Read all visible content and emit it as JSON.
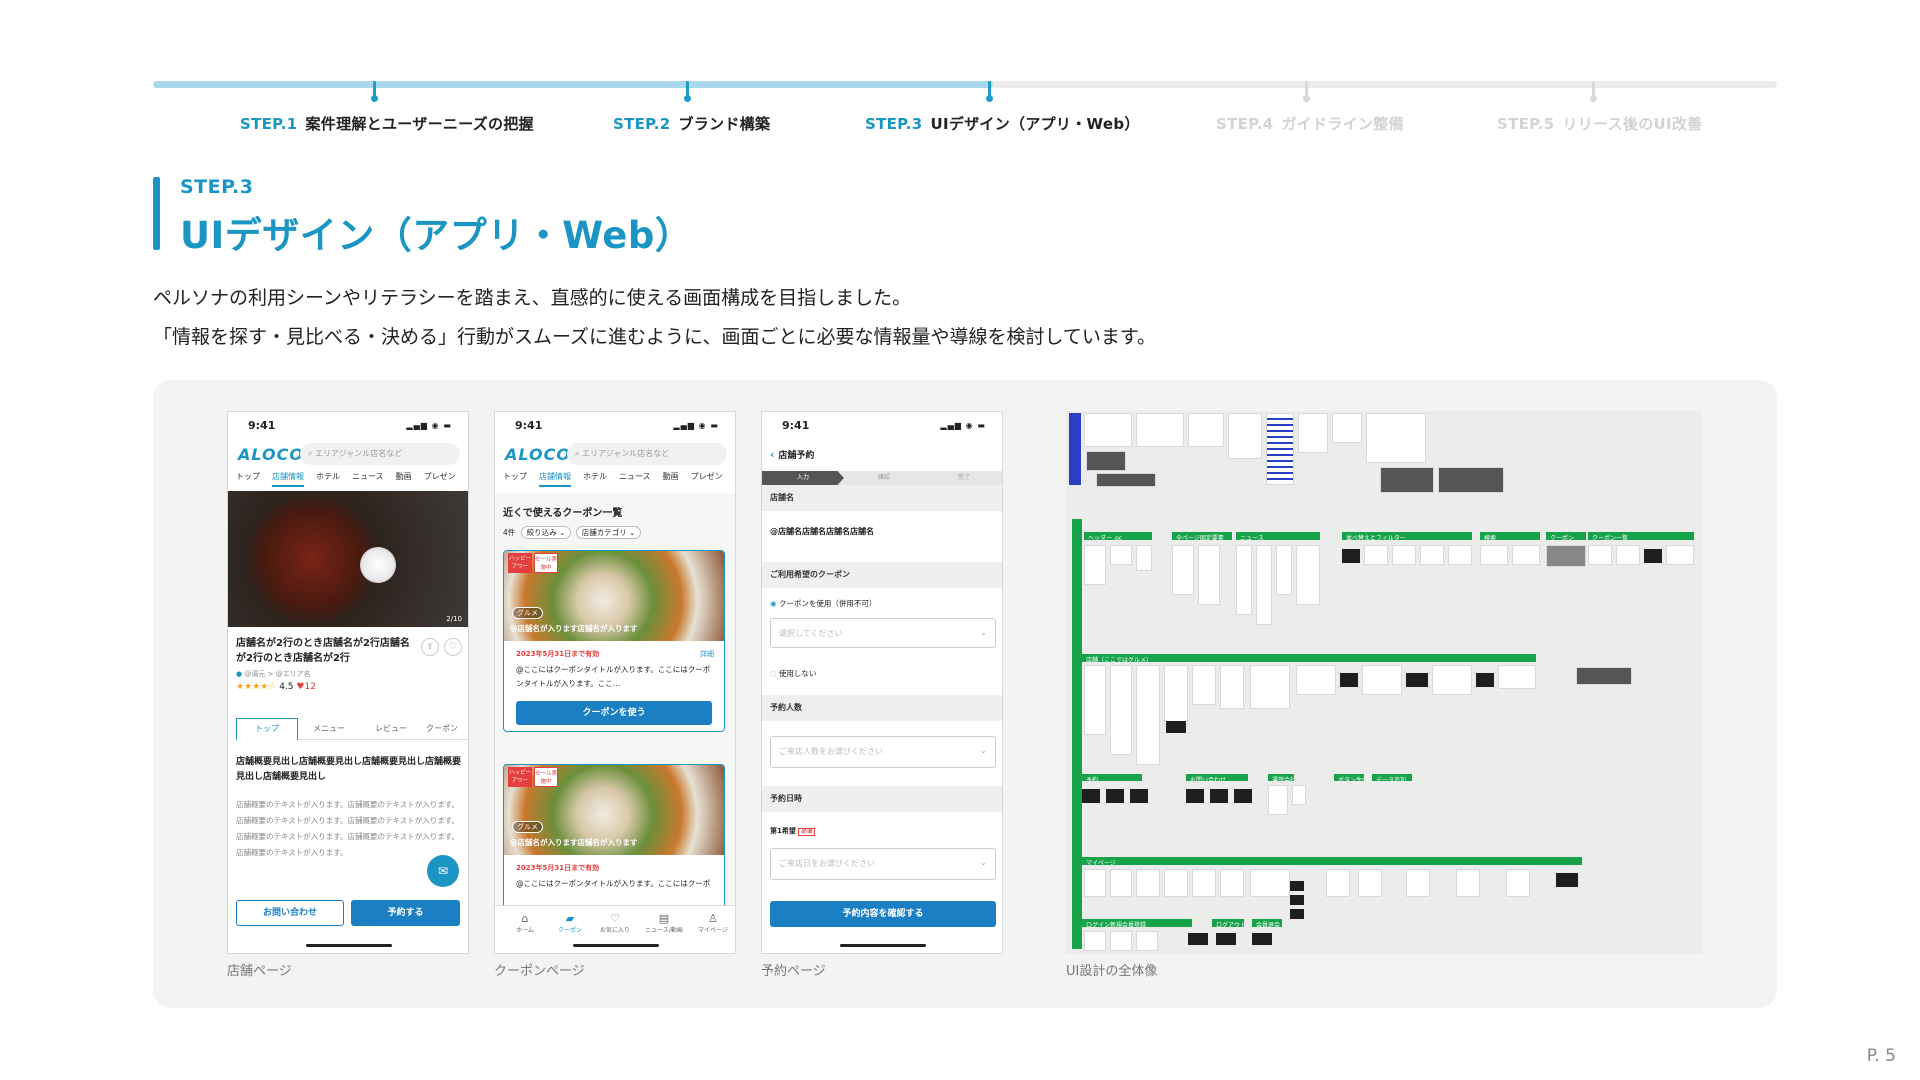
{
  "steps": [
    {
      "num": "STEP.1",
      "title": "案件理解とユーザーニーズの把握",
      "state": "on"
    },
    {
      "num": "STEP.2",
      "title": "ブランド構築",
      "state": "on"
    },
    {
      "num": "STEP.3",
      "title": "UIデザイン（アプリ・Web）",
      "state": "on"
    },
    {
      "num": "STEP.4",
      "title": "ガイドライン整備",
      "state": "off"
    },
    {
      "num": "STEP.5",
      "title": "リリース後のUI改善",
      "state": "off"
    }
  ],
  "section": {
    "step": "STEP.3",
    "title": "UIデザイン（アプリ・Web）"
  },
  "description": [
    "ペルソナの利用シーンやリテラシーを踏まえ、直感的に使える画面構成を目指しました。",
    "「情報を探す・見比べる・決める」行動がスムーズに進むように、画面ごとに必要な情報量や導線を検討しています。"
  ],
  "common": {
    "time": "9:41",
    "brand": "ALOCO",
    "search_placeholder": "エリアジャンル店名など",
    "nav_tabs": [
      "トップ",
      "店舗情報",
      "ホテル",
      "ニュース",
      "動画",
      "プレゼン"
    ]
  },
  "shop": {
    "image_counter": "2/10",
    "name": "店舗名が2行のとき店舗名が2行店舗名が2行のとき店舗名が2行",
    "location": "@湯元 > @エリア名",
    "rating": "4.5",
    "stars": "★★★★☆",
    "likes": "♥12",
    "tabs": [
      "トップ",
      "メニュー",
      "レビュー",
      "クーポン"
    ],
    "heading": "店舗概要見出し店舗概要見出し店舗概要見出し店舗概要見出し店舗概要見出し",
    "body": "店舗概要のテキストが入ります。店舗概要のテキストが入ります。店舗概要のテキストが入ります。店舗概要のテキストが入ります。店舗概要のテキストが入ります。店舗概要のテキストが入ります。店舗概要のテキストが入ります。",
    "inquiry": "お問い合わせ",
    "reserve": "予約する"
  },
  "coupon": {
    "title": "近くで使えるクーポン一覧",
    "count": "4件",
    "filter1": "絞り込み",
    "filter2": "店舗カテゴリ",
    "badge1": "ハッピーアワー",
    "badge2": "セール実施中",
    "genre": "グルメ",
    "shop": "@店舗名が入ります店舗名が入ります",
    "valid": "2023年5月31日まで有効",
    "detail": "詳細",
    "text": "@ここにはクーポンタイトルが入ります。ここにはクーポンタイトルが入ります。ここ…",
    "use": "クーポンを使う",
    "bottom_nav": [
      "ホーム",
      "クーポン",
      "お気に入り",
      "ニュース/動画",
      "マイページ"
    ]
  },
  "reserve": {
    "back_title": "店舗予約",
    "steps": [
      "入力",
      "確認",
      "完了"
    ],
    "shop_label": "店舗名",
    "shop_value": "@店舗名店舗名店舗名店舗名",
    "coupon_label": "ご利用希望のクーポン",
    "use_coupon": "クーポンを使用（併用不可）",
    "select_placeholder": "選択してください",
    "no_coupon": "使用しない",
    "people_label": "予約人数",
    "people_placeholder": "ご来店人数をお選びください",
    "date_label": "予約日時",
    "first_choice": "第1希望",
    "required": "必須",
    "date_placeholder": "ご来店日をお選びください",
    "confirm": "予約内容を確認する"
  },
  "overview": {
    "sections": [
      "ヘッダー_pc",
      "全ページ固定要素",
      "ニュース",
      "並べ替えとフィルター",
      "検索",
      "クーポン",
      "クーポン一覧",
      "店舗（ここではグルメ）",
      "予約",
      "お問い合わせ",
      "運営会社",
      "マイページ",
      "ログイン新規会員登録",
      "ログアウト",
      "会員退会",
      "ボタン生成",
      "データ追加"
    ]
  },
  "captions": [
    "店舗ページ",
    "クーポンページ",
    "予約ページ",
    "UI設計の全体像"
  ],
  "page_number": "P. 5",
  "colors": {
    "accent": "#1b95c4",
    "button": "#1b7fc4",
    "green": "#16a34a",
    "track": "#a9d9ea"
  }
}
